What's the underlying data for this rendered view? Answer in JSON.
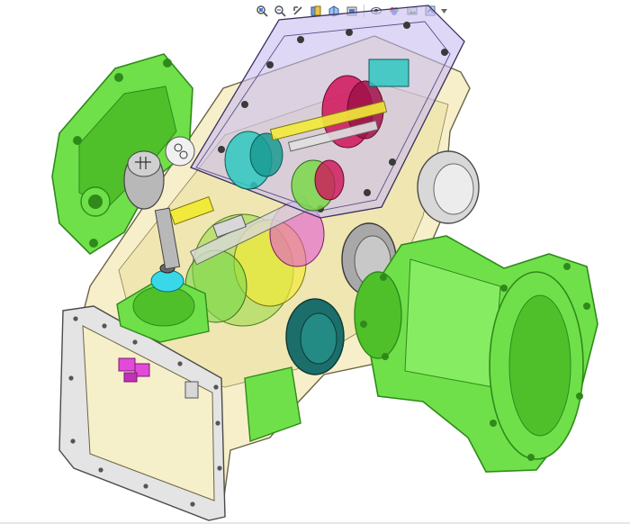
{
  "viewport": {
    "toolbar": {
      "buttons": [
        {
          "name": "zoom-to-fit-icon"
        },
        {
          "name": "zoom-to-area-icon"
        },
        {
          "name": "previous-view-icon"
        },
        {
          "name": "section-view-icon"
        },
        {
          "name": "view-orientation-icon"
        },
        {
          "name": "display-style-icon"
        },
        {
          "name": "hide-show-items-icon"
        },
        {
          "name": "edit-appearance-icon"
        },
        {
          "name": "apply-scene-icon"
        },
        {
          "name": "view-settings-icon"
        }
      ]
    },
    "model": {
      "colors": {
        "housing": "#f0e6a8",
        "housing_edge": "#6b6446",
        "cover_green": "#6fe04a",
        "cover_green_dark": "#2f8a1a",
        "top_cover_purple": "#c9bdf0",
        "gear_teal": "#2ec8c0",
        "gear_red": "#d0145a",
        "gear_green": "#7ad84a",
        "gear_yellow": "#f2ea3a",
        "magenta_part": "#e24ad8",
        "cyan_part": "#38d8e8",
        "grey_cap": "#d8d8d8",
        "dark_teal_cap": "#1c6e6a",
        "gasket_grey": "#e4e4e4",
        "shift_knob": "#b8b8b8"
      }
    }
  }
}
